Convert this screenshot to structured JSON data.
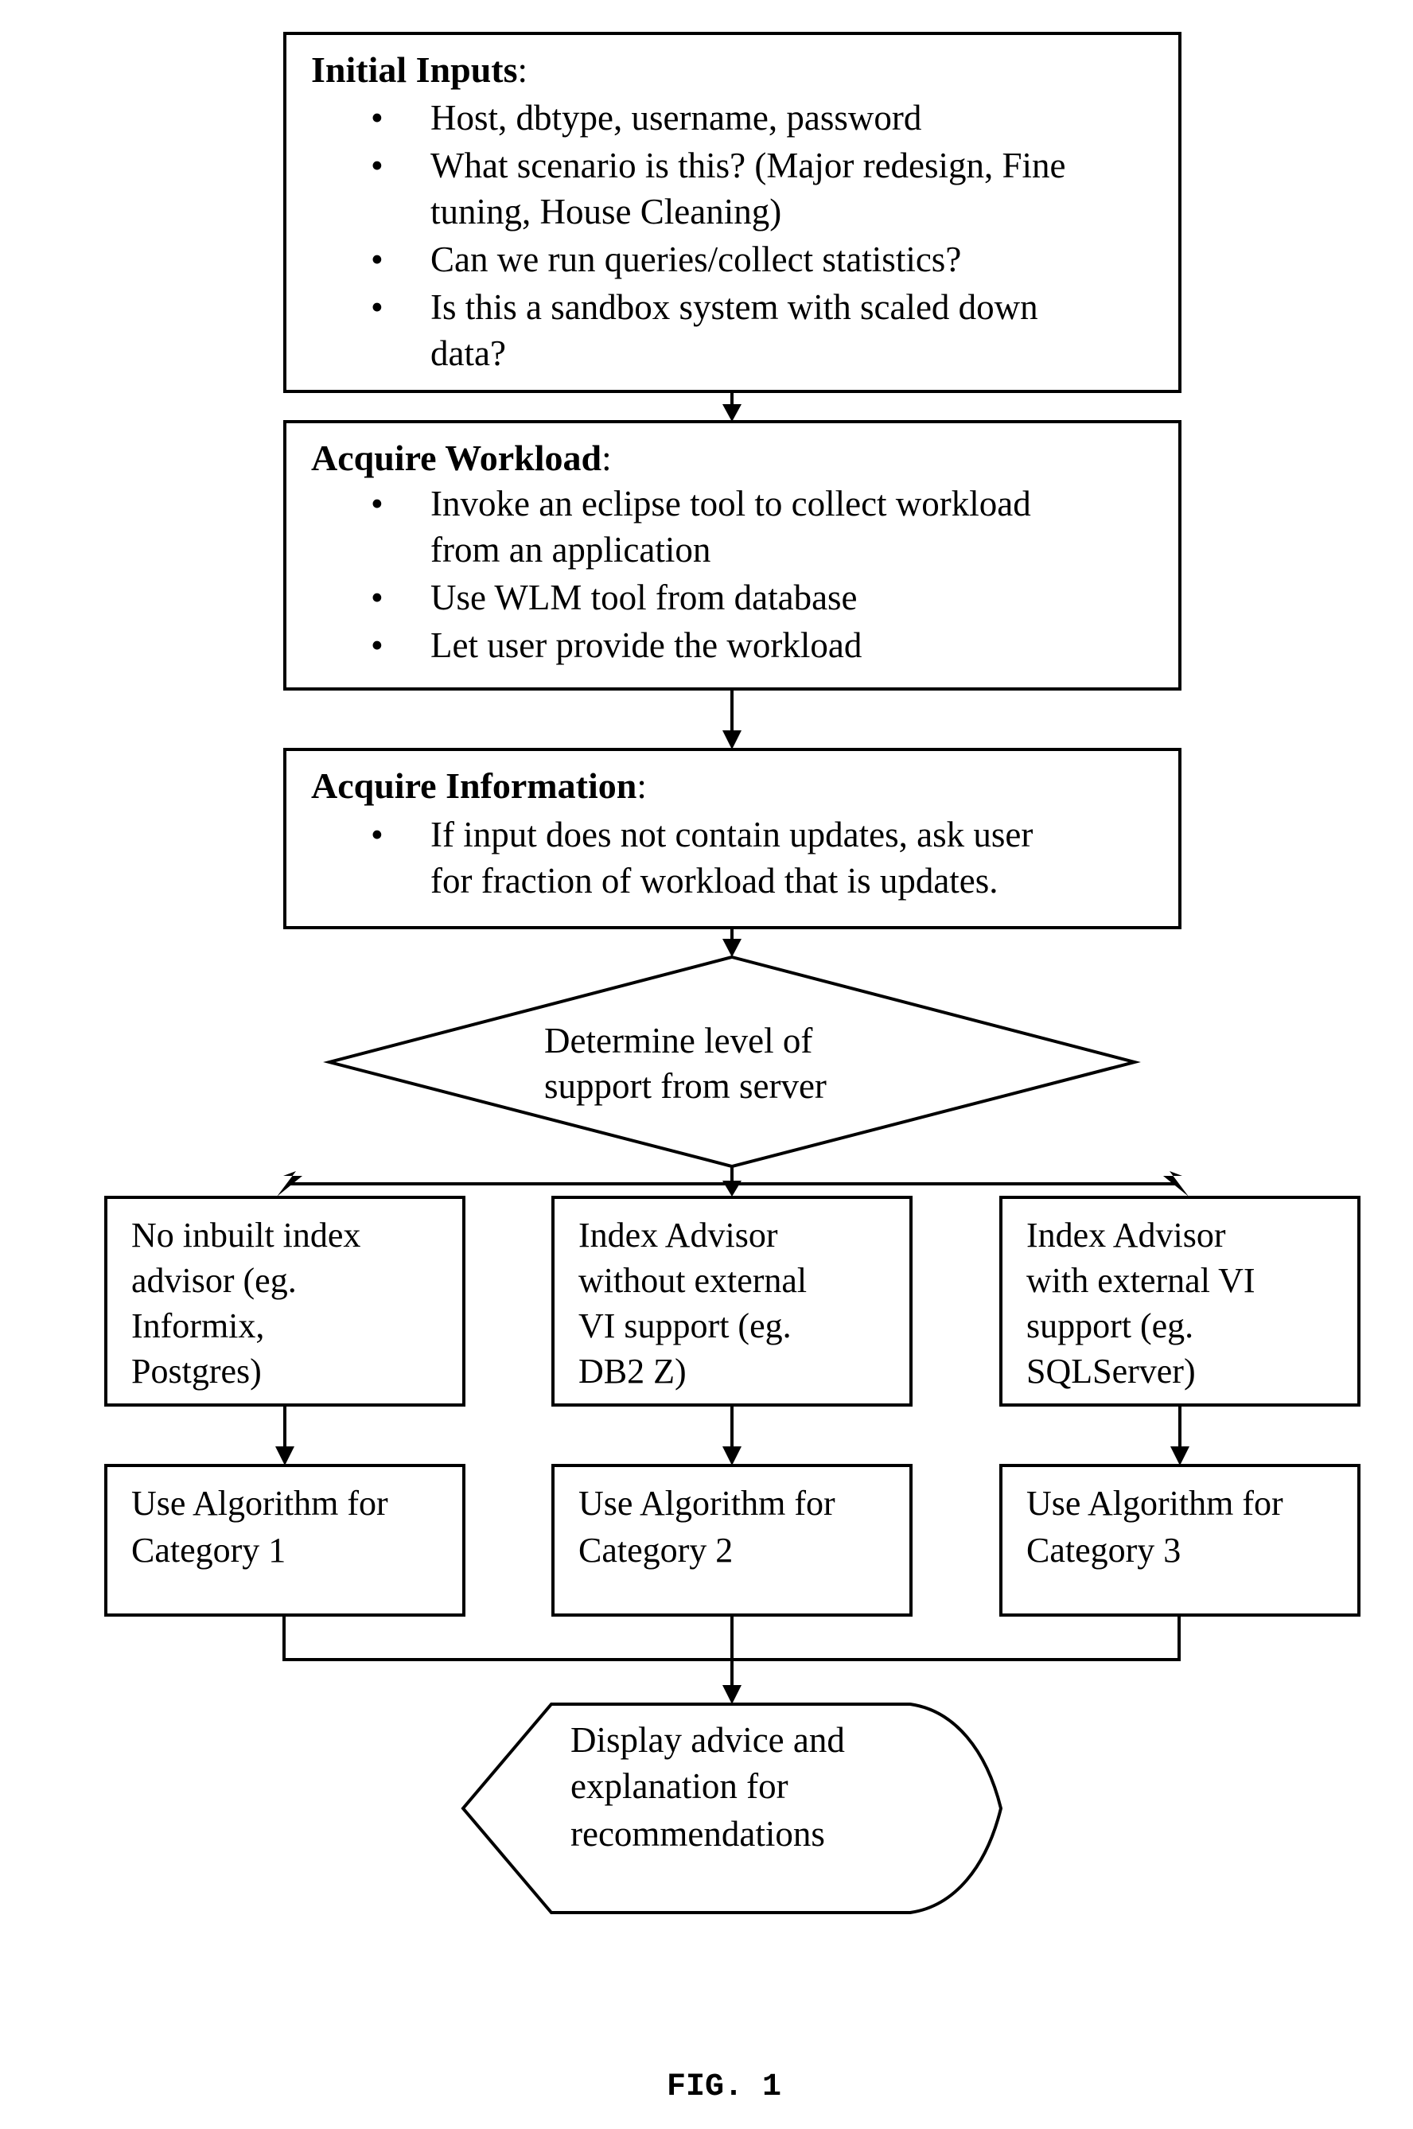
{
  "figure_label": "FIG. 1",
  "steps": {
    "initial_inputs": {
      "title": "Initial Inputs",
      "colon": ":",
      "bullets": [
        [
          "Host, dbtype, username, password"
        ],
        [
          "What scenario is this? (Major redesign, Fine",
          "tuning, House Cleaning)"
        ],
        [
          "Can we run queries/collect statistics?"
        ],
        [
          "Is this a sandbox system with scaled down",
          "data?"
        ]
      ]
    },
    "acquire_workload": {
      "title": "Acquire Workload",
      "colon": ":",
      "bullets": [
        [
          "Invoke an eclipse tool to collect workload",
          "from an application"
        ],
        [
          "Use WLM tool from database"
        ],
        [
          "Let user provide the workload"
        ]
      ]
    },
    "acquire_information": {
      "title": "Acquire Information",
      "colon": ":",
      "bullets": [
        [
          "If input does not contain updates, ask user",
          "for fraction of workload that is updates."
        ]
      ]
    },
    "decision": {
      "lines": [
        "Determine level of",
        "support from server"
      ]
    },
    "categories": [
      {
        "lines": [
          "No inbuilt index",
          "advisor (eg.",
          "Informix,",
          "Postgres)"
        ],
        "algorithm": [
          "Use Algorithm for",
          "Category 1"
        ]
      },
      {
        "lines": [
          "Index Advisor",
          "without external",
          "VI support (eg.",
          "DB2 Z)"
        ],
        "algorithm": [
          "Use Algorithm for",
          "Category 2"
        ]
      },
      {
        "lines": [
          "Index Advisor",
          "with external VI",
          "support (eg.",
          "SQLServer)"
        ],
        "algorithm": [
          "Use Algorithm for",
          "Category 3"
        ]
      }
    ],
    "display": {
      "lines": [
        "Display advice and",
        "explanation for",
        "recommendations"
      ]
    }
  },
  "bullet_glyph": "•"
}
